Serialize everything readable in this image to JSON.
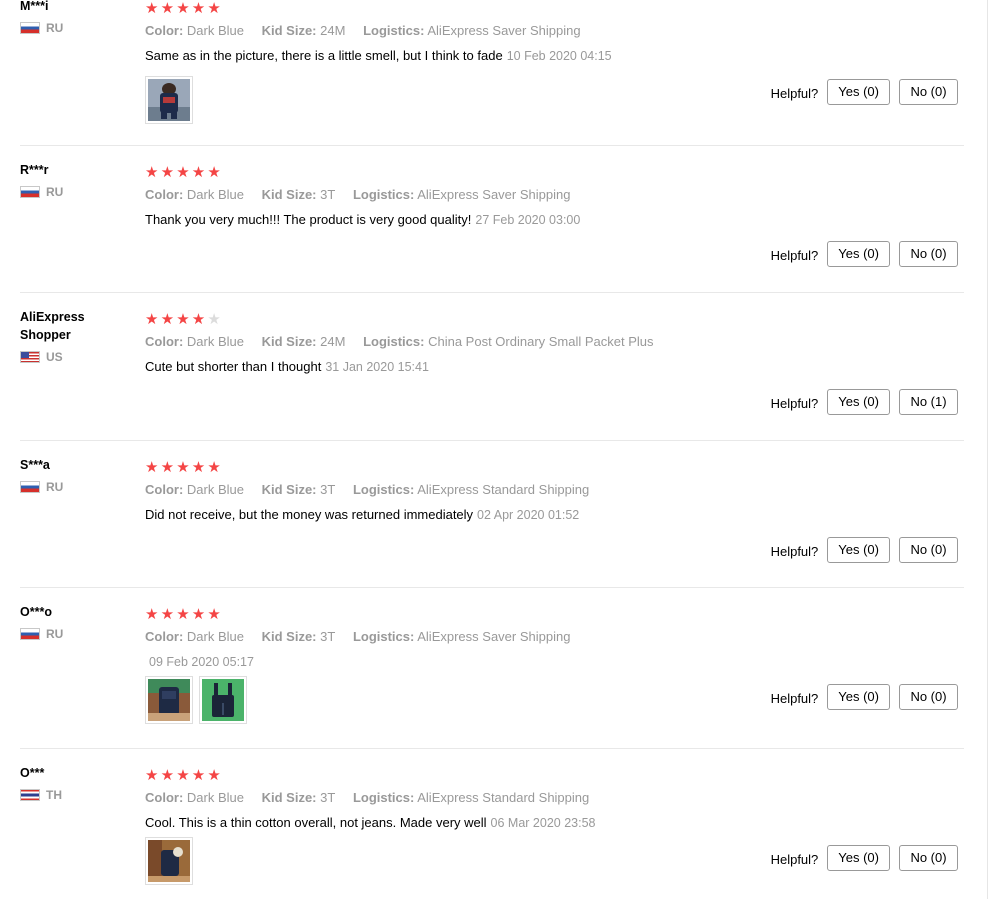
{
  "helpful_label": "Helpful?",
  "reviews": [
    {
      "user": "M***i",
      "country": "RU",
      "rating": 5,
      "color_key": "Color:",
      "color": "Dark Blue",
      "size_key": "Kid Size:",
      "size": "24M",
      "logistics_key": "Logistics:",
      "logistics": "AliExpress Saver Shipping",
      "text": "Same as in the picture, there is a little smell, but I think to fade",
      "time": "10 Feb 2020 04:15",
      "photos": 1,
      "yes": "Yes (0)",
      "no": "No (0)"
    },
    {
      "user": "R***r",
      "country": "RU",
      "rating": 5,
      "color_key": "Color:",
      "color": "Dark Blue",
      "size_key": "Kid Size:",
      "size": "3T",
      "logistics_key": "Logistics:",
      "logistics": "AliExpress Saver Shipping",
      "text": "Thank you very much!!! The product is very good quality!",
      "time": "27 Feb 2020 03:00",
      "photos": 0,
      "yes": "Yes (0)",
      "no": "No (0)"
    },
    {
      "user": "AliExpress Shopper",
      "country": "US",
      "rating": 4,
      "color_key": "Color:",
      "color": "Dark Blue",
      "size_key": "Kid Size:",
      "size": "24M",
      "logistics_key": "Logistics:",
      "logistics": "China Post Ordinary Small Packet Plus",
      "text": "Cute but shorter than I thought",
      "time": "31 Jan 2020 15:41",
      "photos": 0,
      "yes": "Yes (0)",
      "no": "No (1)"
    },
    {
      "user": "S***a",
      "country": "RU",
      "rating": 5,
      "color_key": "Color:",
      "color": "Dark Blue",
      "size_key": "Kid Size:",
      "size": "3T",
      "logistics_key": "Logistics:",
      "logistics": "AliExpress Standard Shipping",
      "text": "Did not receive, but the money was returned immediately",
      "time": "02 Apr 2020 01:52",
      "photos": 0,
      "yes": "Yes (0)",
      "no": "No (0)"
    },
    {
      "user": "O***o",
      "country": "RU",
      "rating": 5,
      "color_key": "Color:",
      "color": "Dark Blue",
      "size_key": "Kid Size:",
      "size": "3T",
      "logistics_key": "Logistics:",
      "logistics": "AliExpress Saver Shipping",
      "text": "",
      "time": "09 Feb 2020 05:17",
      "photos": 2,
      "yes": "Yes (0)",
      "no": "No (0)"
    },
    {
      "user": "O***",
      "country": "TH",
      "rating": 5,
      "color_key": "Color:",
      "color": "Dark Blue",
      "size_key": "Kid Size:",
      "size": "3T",
      "logistics_key": "Logistics:",
      "logistics": "AliExpress Standard Shipping",
      "text": "Cool. This is a thin cotton overall, not jeans. Made very well",
      "time": "06 Mar 2020 23:58",
      "photos": 1,
      "yes": "Yes (0)",
      "no": "No (0)"
    }
  ],
  "colors": {
    "star_on": "#f44545",
    "star_off": "#dcdcdc",
    "muted_text": "#999999",
    "divider": "#e8e8e8"
  }
}
